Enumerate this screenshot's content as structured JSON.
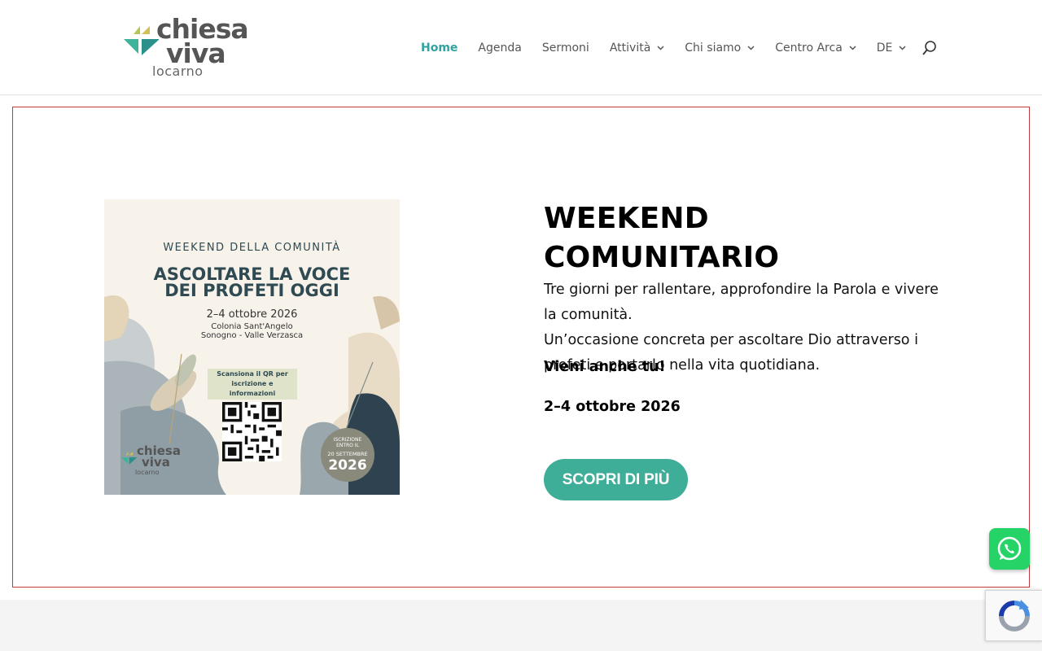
{
  "logo": {
    "line1": "chiesa",
    "line2": "viva",
    "line3": "locarno"
  },
  "nav": {
    "items": [
      {
        "label": "Home",
        "active": true,
        "dropdown": false
      },
      {
        "label": "Agenda",
        "active": false,
        "dropdown": false
      },
      {
        "label": "Sermoni",
        "active": false,
        "dropdown": false
      },
      {
        "label": "Attività",
        "active": false,
        "dropdown": true
      },
      {
        "label": "Chi siamo",
        "active": false,
        "dropdown": true
      },
      {
        "label": "Centro Arca",
        "active": false,
        "dropdown": true
      },
      {
        "label": "DE",
        "active": false,
        "dropdown": true
      }
    ],
    "search_icon": "search-icon"
  },
  "poster": {
    "kicker": "WEEKEND DELLA COMUNITÀ",
    "title_line1": "ASCOLTARE LA VOCE",
    "title_line2": "DEI PROFETI OGGI",
    "date": "2–4 ottobre 2026",
    "location_line1": "Colonia Sant'Angelo",
    "location_line2": "Sonogno - Valle Verzasca",
    "scan_line1": "Scansiona il QR per",
    "scan_line2": "iscrizione e informazioni",
    "badge_line1": "ISCRIZIONE",
    "badge_line2": "ENTRO IL",
    "badge_line3": "20 SETTEMBRE",
    "badge_year": "2026",
    "mini_logo_line1": "chiesa",
    "mini_logo_line2": "viva",
    "mini_logo_line3": "locarno"
  },
  "hero": {
    "title": "WEEKEND COMUNITARIO",
    "paragraph1": "Tre giorni per rallentare, approfondire la Parola e vivere la comunità.",
    "paragraph2": "Un’occasione concreta per ascoltare Dio attraverso i profeti e portarlo nella vita quotidiana.",
    "invite": "Vieni anche tu!",
    "dates": "2–4 ottobre 2026",
    "cta_label": "SCOPRI DI PIÙ"
  },
  "colors": {
    "accent": "#2ea3a0",
    "cta": "#3fae99",
    "section_border": "#c0393b",
    "whatsapp": "#25d366"
  }
}
